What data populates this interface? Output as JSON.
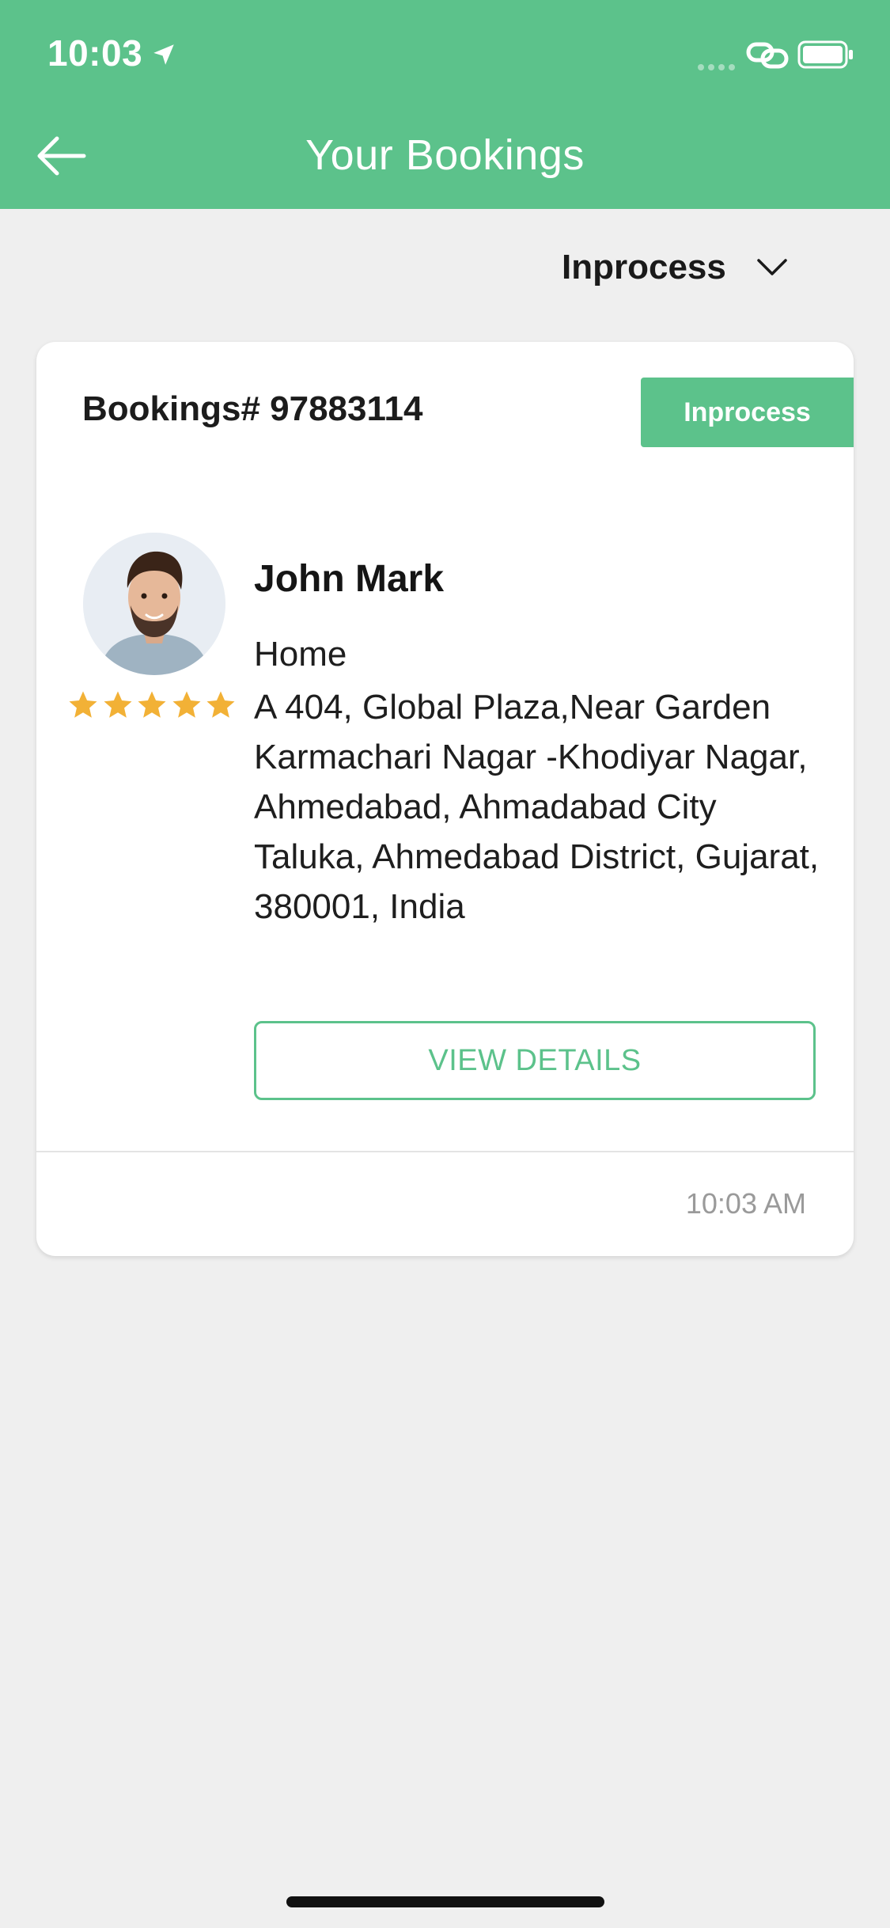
{
  "status_bar": {
    "time": "10:03",
    "icons": [
      "location-arrow-icon",
      "signal-dots-icon",
      "link-icon",
      "battery-icon"
    ]
  },
  "header": {
    "title": "Your Bookings",
    "back_icon": "arrow-left-icon"
  },
  "filter": {
    "selected": "Inprocess",
    "icon": "chevron-down-icon"
  },
  "booking": {
    "id_text": "Bookings# 97883114",
    "status": "Inprocess",
    "customer_name": "John Mark",
    "rating_stars": 5,
    "address_type": "Home",
    "address": "A 404, Global Plaza,Near Garden Karmachari Nagar -Khodiyar Nagar, Ahmedabad, Ahmadabad City Taluka, Ahmedabad District, Gujarat, 380001, India",
    "view_details_label": "VIEW DETAILS",
    "time": "10:03 AM"
  },
  "colors": {
    "accent": "#5cc28b",
    "star": "#f2b136",
    "background": "#efefef"
  }
}
